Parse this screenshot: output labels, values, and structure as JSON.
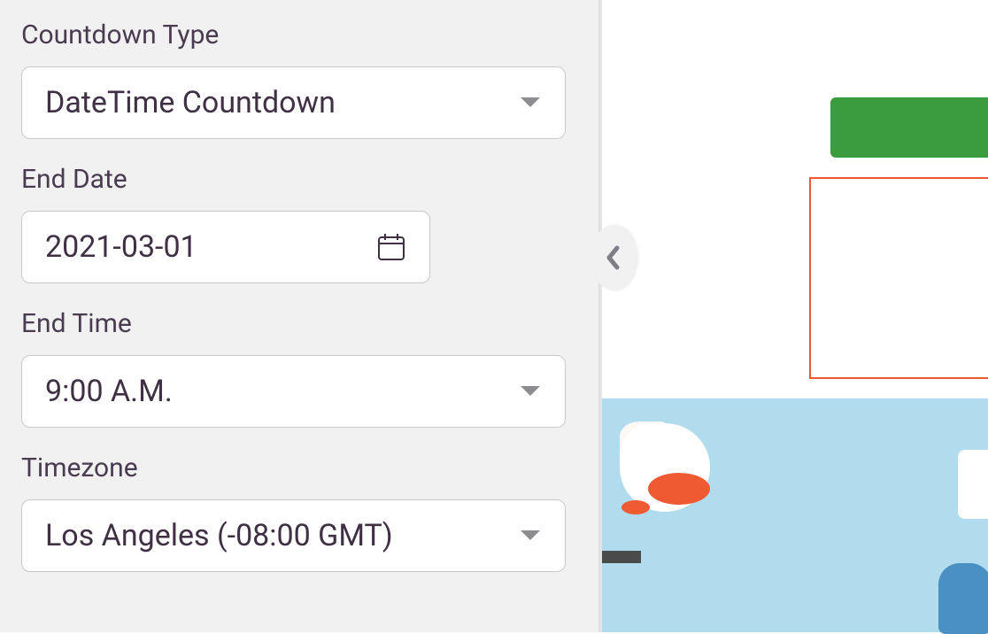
{
  "sidebar": {
    "countdown_type": {
      "label": "Countdown Type",
      "value": "DateTime Countdown"
    },
    "end_date": {
      "label": "End Date",
      "value": "2021-03-01"
    },
    "end_time": {
      "label": "End Time",
      "value": "9:00 A.M."
    },
    "timezone": {
      "label": "Timezone",
      "value": "Los Angeles (-08:00 GMT)"
    }
  },
  "colors": {
    "green_button": "#3b9b3f",
    "accent_orange": "#ef5a32",
    "sky": "#b1dced"
  }
}
